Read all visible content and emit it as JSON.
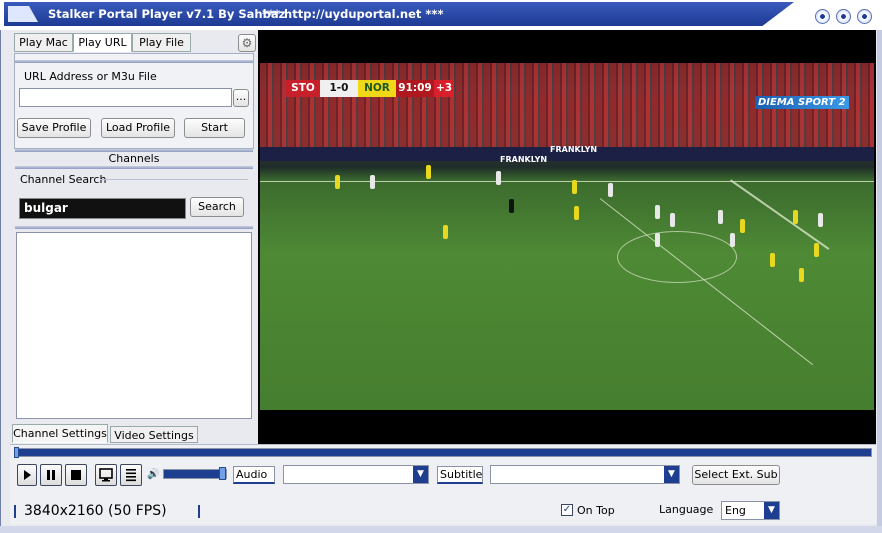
{
  "window": {
    "title": "Stalker Portal Player v7.1 By Sahbaz",
    "url": "*** http://uyduportal.net ***"
  },
  "tabs": [
    {
      "label": "Play Mac",
      "active": false
    },
    {
      "label": "Play URL",
      "active": true
    },
    {
      "label": "Play File",
      "active": false
    }
  ],
  "url_section": {
    "label": "URL Address or M3u File",
    "value": "",
    "browse_label": "...",
    "save_profile_label": "Save Profile",
    "load_profile_label": "Load Profile",
    "start_label": "Start"
  },
  "channels": {
    "header": "Channels",
    "search_label": "Channel Search",
    "search_value": "bulgar",
    "search_button": "Search",
    "items": []
  },
  "bottom_tabs": [
    {
      "label": "Channel Settings",
      "active": true
    },
    {
      "label": "Video Settings",
      "active": false
    }
  ],
  "video": {
    "scoreboard": {
      "home": "STO",
      "score": "1-0",
      "away": "NOR",
      "time": "91:09",
      "added": "+3"
    },
    "channel_logo": "DIEMA SPORT 2",
    "ad_text_1": "FRANKLYN",
    "ad_text_2": "FRANKLYN"
  },
  "controls": {
    "audio_label": "Audio",
    "audio_value": "",
    "subtitle_label": "Subtitle",
    "subtitle_value": "",
    "select_ext_sub_label": "Select Ext. Sub",
    "volume": 1.0,
    "progress": 0.0
  },
  "status": {
    "resolution": "3840x2160",
    "fps": "(50 FPS)",
    "on_top_label": "On Top",
    "on_top_checked": true,
    "language_label": "Language",
    "language_value": "Eng"
  },
  "colors": {
    "title_bar": "#1d3a93",
    "accent": "#1e3f8f",
    "pitch": "#4e8a35"
  }
}
